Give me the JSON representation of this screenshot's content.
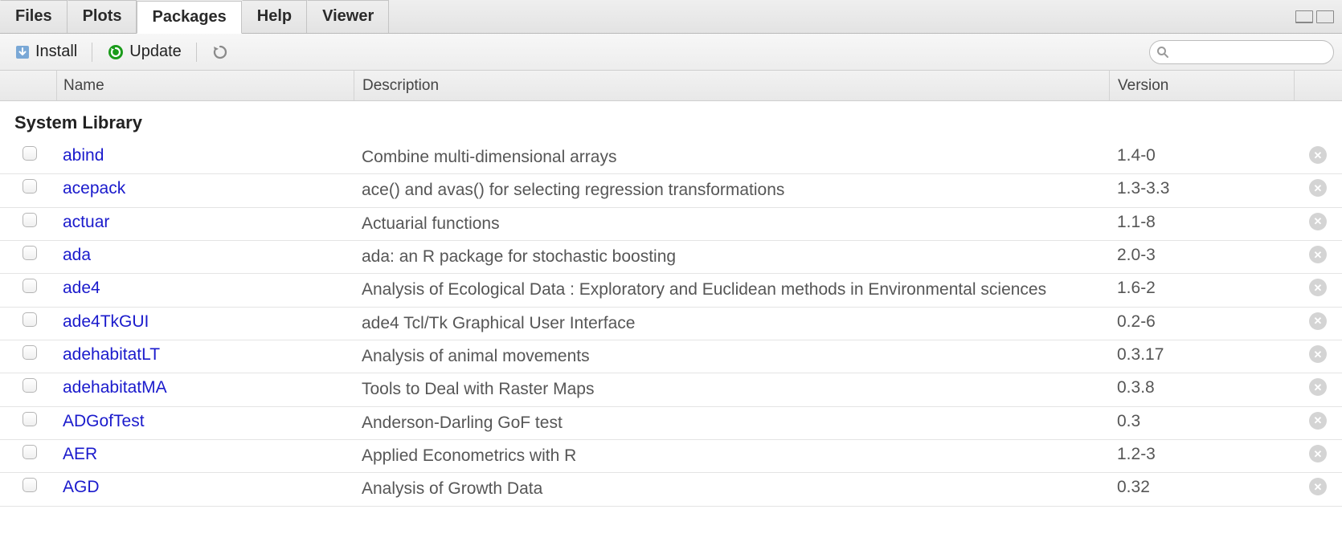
{
  "tabs": [
    {
      "label": "Files",
      "active": false
    },
    {
      "label": "Plots",
      "active": false
    },
    {
      "label": "Packages",
      "active": true
    },
    {
      "label": "Help",
      "active": false
    },
    {
      "label": "Viewer",
      "active": false
    }
  ],
  "toolbar": {
    "install_label": "Install",
    "update_label": "Update",
    "search_placeholder": ""
  },
  "columns": {
    "name": "Name",
    "description": "Description",
    "version": "Version"
  },
  "section_heading": "System Library",
  "packages": [
    {
      "name": "abind",
      "description": "Combine multi-dimensional arrays",
      "version": "1.4-0"
    },
    {
      "name": "acepack",
      "description": "ace() and avas() for selecting regression transformations",
      "version": "1.3-3.3"
    },
    {
      "name": "actuar",
      "description": "Actuarial functions",
      "version": "1.1-8"
    },
    {
      "name": "ada",
      "description": "ada: an R package for stochastic boosting",
      "version": "2.0-3"
    },
    {
      "name": "ade4",
      "description": "Analysis of Ecological Data : Exploratory and Euclidean methods in Environmental sciences",
      "version": "1.6-2"
    },
    {
      "name": "ade4TkGUI",
      "description": "ade4 Tcl/Tk Graphical User Interface",
      "version": "0.2-6"
    },
    {
      "name": "adehabitatLT",
      "description": "Analysis of animal movements",
      "version": "0.3.17"
    },
    {
      "name": "adehabitatMA",
      "description": "Tools to Deal with Raster Maps",
      "version": "0.3.8"
    },
    {
      "name": "ADGofTest",
      "description": "Anderson-Darling GoF test",
      "version": "0.3"
    },
    {
      "name": "AER",
      "description": "Applied Econometrics with R",
      "version": "1.2-3"
    },
    {
      "name": "AGD",
      "description": "Analysis of Growth Data",
      "version": "0.32"
    }
  ]
}
